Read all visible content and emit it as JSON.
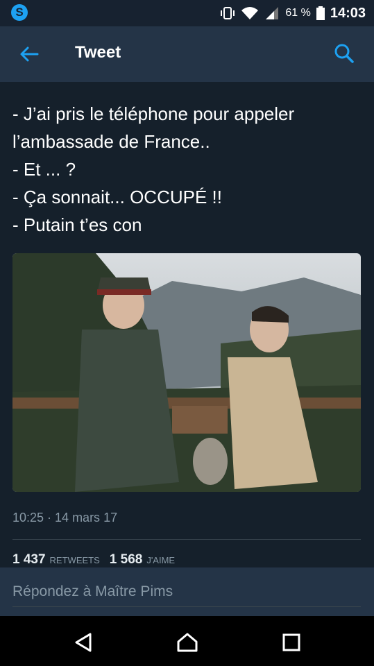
{
  "status_bar": {
    "app_icon": "s-logo-icon",
    "battery_percent": "61 %",
    "time": "14:03",
    "icons": [
      "vibrate-icon",
      "wifi-icon",
      "signal-icon",
      "battery-icon"
    ]
  },
  "header": {
    "title": "Tweet",
    "back_icon": "arrow-left-icon",
    "search_icon": "search-icon",
    "accent": "#1da1f2"
  },
  "tweet": {
    "lines": [
      "- J’ai pris le téléphone pour appeler",
      "l’ambassade de France..",
      "- Et ... ?",
      "- Ça sonnait... OCCUPÉ !!",
      "- Putain t’es con"
    ],
    "timestamp": "10:25 · 14 mars 17",
    "retweets_count": "1 437",
    "retweets_label": "RETWEETS",
    "likes_count": "1 568",
    "likes_label": "J'AIME"
  },
  "reply": {
    "placeholder": "Répondez à Maître Pims"
  },
  "nav": {
    "back": "back-triangle-icon",
    "home": "home-icon",
    "recents": "recents-square-icon"
  }
}
